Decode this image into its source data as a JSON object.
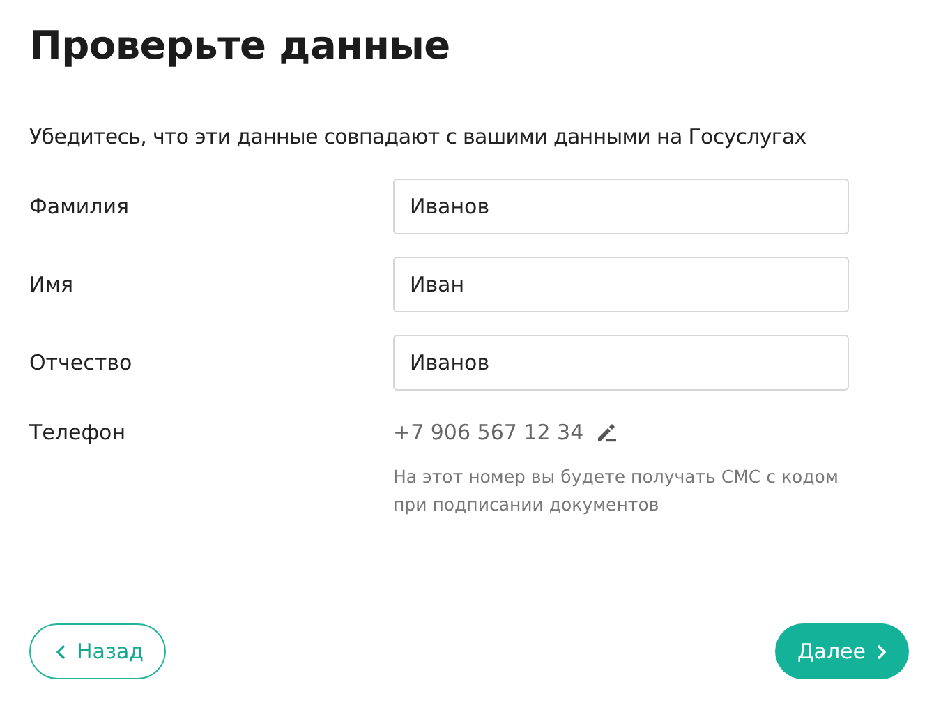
{
  "title": "Проверьте данные",
  "subtitle": "Убедитесь, что эти данные совпадают с вашими данными на Госуслугах",
  "fields": [
    {
      "label": "Фамилия",
      "value": "Иванов"
    },
    {
      "label": "Имя",
      "value": "Иван"
    },
    {
      "label": "Отчество",
      "value": "Иванов"
    }
  ],
  "phone": {
    "label": "Телефон",
    "value": "+7 906 567 12 34",
    "hint": "На этот номер вы будете получать СМС с кодом при подписании документов"
  },
  "buttons": {
    "back": "Назад",
    "next": "Далее"
  }
}
